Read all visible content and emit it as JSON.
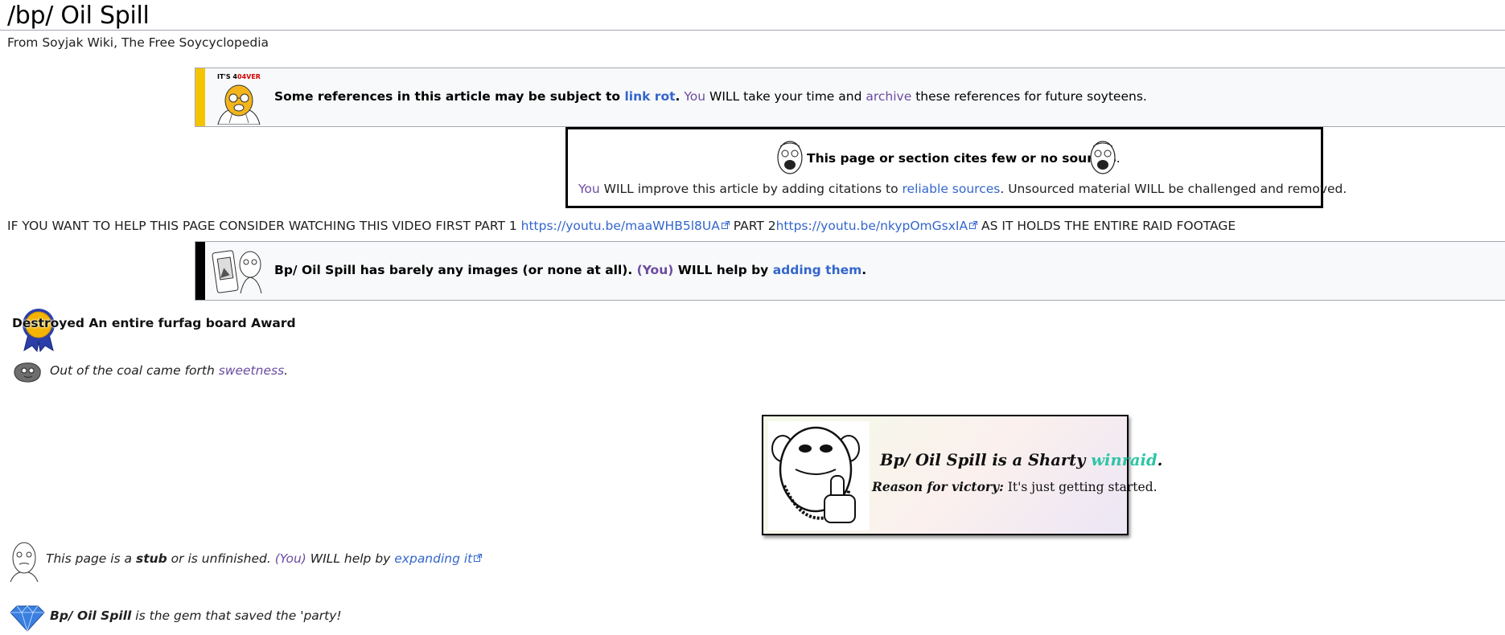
{
  "page": {
    "title": "/bp/ Oil Spill",
    "tagline": "From Soyjak Wiki, The Free Soycyclopedia"
  },
  "linkrot": {
    "badge_prefix": "IT'S 4",
    "badge_mid": "04",
    "badge_suffix": "VER",
    "bold": "Some references in this article may be subject to ",
    "link": "link rot",
    "bold_end": ".",
    "you": "You",
    "mid": " WILL take your time and ",
    "archive": "archive",
    "end": " these references for future soyteens.",
    "stripe_color": "#f5c400"
  },
  "cite": {
    "heading": "This page or section cites few or no sources",
    "heading_end": ".",
    "you": "You",
    "mid": " WILL improve this article by adding citations to ",
    "link": "reliable sources",
    "end": ". Unsourced material WILL be challenged and removed."
  },
  "help": {
    "pre": "IF YOU WANT TO HELP THIS PAGE CONSIDER WATCHING THIS VIDEO FIRST PART 1 ",
    "link1": "https://youtu.be/maaWHB5l8UA",
    "mid": " PART 2",
    "link2": "https://youtu.be/nkypOmGsxIA",
    "end": " AS IT HOLDS THE ENTIRE RAID FOOTAGE"
  },
  "images_box": {
    "text1": "Bp/ Oil Spill has barely any images (or none at all). ",
    "you": "(You)",
    "text2": " WILL help by ",
    "link": "adding them",
    "end": ".",
    "stripe_color": "#000000"
  },
  "award": {
    "text": "Destroyed An entire furfag board Award"
  },
  "coal": {
    "text": "Out of the coal came forth ",
    "link": "sweetness",
    "end": "."
  },
  "winraid": {
    "l1_pre": "Bp/ Oil Spill is a Sharty ",
    "l1_link": "winraid",
    "l1_end": ".",
    "reason_label": "Reason for victory:",
    "reason": " It's just getting started."
  },
  "stub": {
    "pre": "This page is a ",
    "bold": "stub",
    "mid": " or is unfinished. ",
    "you": "(You)",
    "mid2": " WILL help by ",
    "link": "expanding it"
  },
  "gem": {
    "bold": "Bp/ Oil Spill",
    "text": " is the gem that saved the 'party!"
  }
}
